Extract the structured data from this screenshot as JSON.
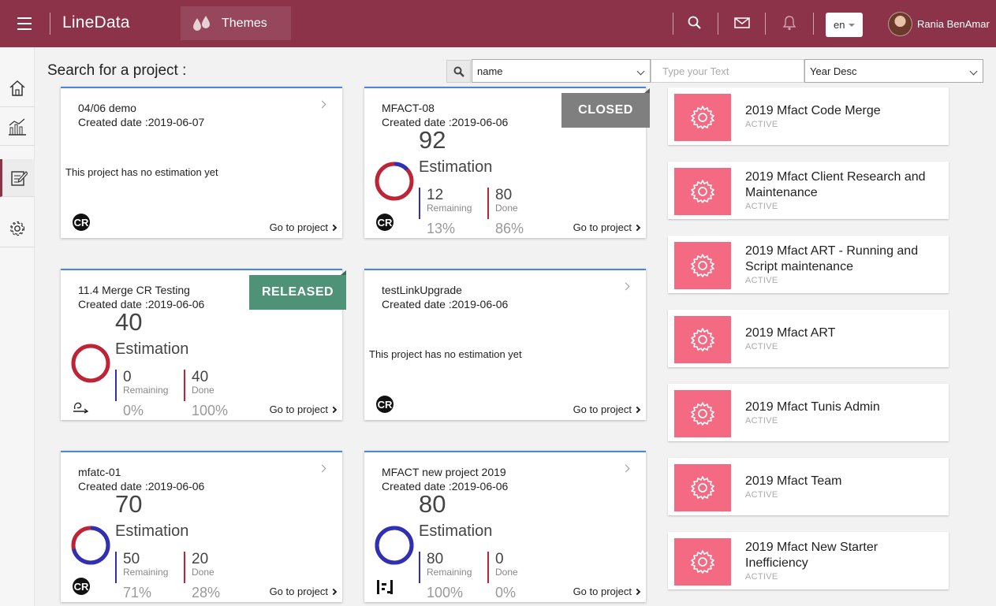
{
  "topbar": {
    "brand": "LineData",
    "themes_label": "Themes",
    "language": "en",
    "user_name": "Rania BenAmar",
    "icons": [
      "menu-icon",
      "drops-icon",
      "search-icon",
      "mail-icon",
      "bell-icon"
    ]
  },
  "sidebar": {
    "items": [
      {
        "icon": "home-icon"
      },
      {
        "icon": "chart-icon"
      },
      {
        "icon": "edit-icon",
        "active": true
      },
      {
        "icon": "gear-icon"
      }
    ]
  },
  "search": {
    "title": "Search for a project :",
    "field_select": "name",
    "text_placeholder": "Type your Text",
    "sort_select": "Year Desc"
  },
  "projects": [
    {
      "name": "04/06 demo",
      "created": "Created date :2019-06-07",
      "no_estimation": "This project has no estimation yet",
      "goto": "Go to project"
    },
    {
      "name": "MFACT-08",
      "created": "Created date :2019-06-06",
      "ribbon": "CLOSED",
      "total": "92",
      "estimation": "Estimation",
      "remaining": "12",
      "remaining_label": "Remaining",
      "remaining_pct": "13%",
      "done": "80",
      "done_label": "Done",
      "done_pct": "86%",
      "goto": "Go to project"
    },
    {
      "name": "11.4 Merge CR Testing",
      "created": "Created date :2019-06-06",
      "ribbon": "RELEASED",
      "total": "40",
      "estimation": "Estimation",
      "remaining": "0",
      "remaining_label": "Remaining",
      "remaining_pct": "0%",
      "done": "40",
      "done_label": "Done",
      "done_pct": "100%",
      "goto": "Go to project"
    },
    {
      "name": "testLinkUpgrade",
      "created": "Created date :2019-06-06",
      "no_estimation": "This project has no estimation yet",
      "goto": "Go to project"
    },
    {
      "name": "mfatc-01",
      "created": "Created date :2019-06-06",
      "total": "70",
      "estimation": "Estimation",
      "remaining": "50",
      "remaining_label": "Remaining",
      "remaining_pct": "71%",
      "done": "20",
      "done_label": "Done",
      "done_pct": "28%",
      "goto": "Go to project"
    },
    {
      "name": "MFACT new project 2019",
      "created": "Created date :2019-06-06",
      "total": "80",
      "estimation": "Estimation",
      "remaining": "80",
      "remaining_label": "Remaining",
      "remaining_pct": "100%",
      "done": "0",
      "done_label": "Done",
      "done_pct": "0%",
      "goto": "Go to project"
    }
  ],
  "themes": [
    {
      "name": "2019 Mfact Code Merge",
      "status": "ACTIVE"
    },
    {
      "name": "2019 Mfact Client Research and Maintenance",
      "status": "ACTIVE"
    },
    {
      "name": "2019 Mfact ART - Running and Script maintenance",
      "status": "ACTIVE"
    },
    {
      "name": "2019 Mfact ART",
      "status": "ACTIVE"
    },
    {
      "name": "2019 Mfact Tunis Admin",
      "status": "ACTIVE"
    },
    {
      "name": "2019 Mfact Team",
      "status": "ACTIVE"
    },
    {
      "name": "2019 Mfact New Starter Inefficiency",
      "status": "ACTIVE"
    }
  ],
  "colors": {
    "topbar": "#8c3349",
    "closed_ribbon": "#7f7f7f",
    "released_ribbon": "#4e9377",
    "remaining": "#2e31b4",
    "done": "#bd2436",
    "theme_icon_bg": "#f46a83"
  }
}
